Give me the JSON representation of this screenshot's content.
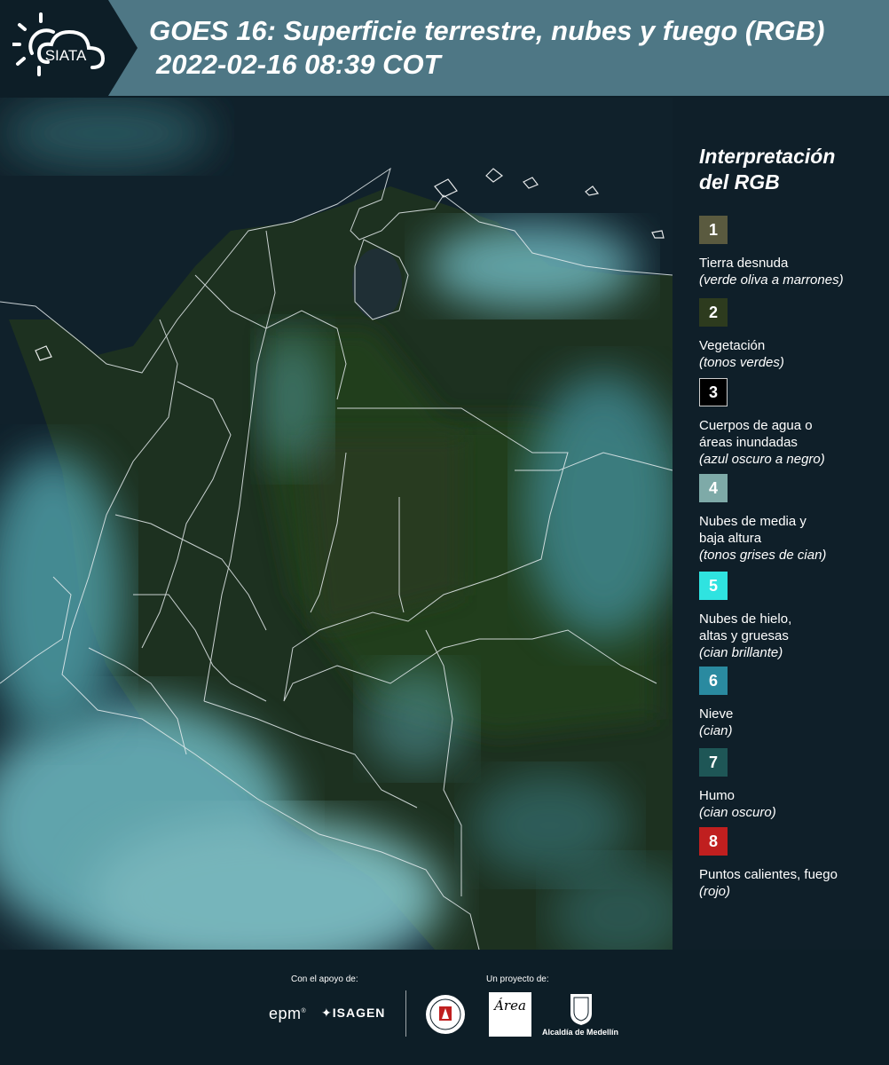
{
  "header": {
    "logo_text": "SIATA",
    "title_line1": "GOES 16: Superficie terrestre, nubes y fuego (RGB)",
    "title_line2": "2022-02-16 08:39 COT"
  },
  "legend": {
    "title_line1": "Interpretación",
    "title_line2": "del RGB",
    "items": [
      {
        "num": "1",
        "color": "#5a5a3f",
        "label": "Tierra desnuda",
        "note": "(verde oliva a marrones)"
      },
      {
        "num": "2",
        "color": "#2d3b1e",
        "label": "Vegetación",
        "note": "(tonos verdes)"
      },
      {
        "num": "3",
        "color": "#000000",
        "label": "Cuerpos de agua o áreas inundadas",
        "note": "(azul oscuro a negro)"
      },
      {
        "num": "4",
        "color": "#7eaaa8",
        "label": "Nubes de media y baja altura",
        "note": "(tonos grises de cian)"
      },
      {
        "num": "5",
        "color": "#2fe3e0",
        "label": "Nubes de hielo, altas y gruesas",
        "note": "(cian brillante)"
      },
      {
        "num": "6",
        "color": "#2a8aa0",
        "label": "Nieve",
        "note": "(cian)"
      },
      {
        "num": "7",
        "color": "#1e5656",
        "label": "Humo",
        "note": "(cian oscuro)"
      },
      {
        "num": "8",
        "color": "#c01f1f",
        "label": "Puntos calientes, fuego",
        "note": "(rojo)"
      }
    ]
  },
  "footer": {
    "support_label": "Con el apoyo de:",
    "project_label": "Un proyecto de:",
    "epm": "epm",
    "isagen": "ISAGEN",
    "area_text": "Área",
    "alcaldia": "Alcaldía de Medellín"
  }
}
